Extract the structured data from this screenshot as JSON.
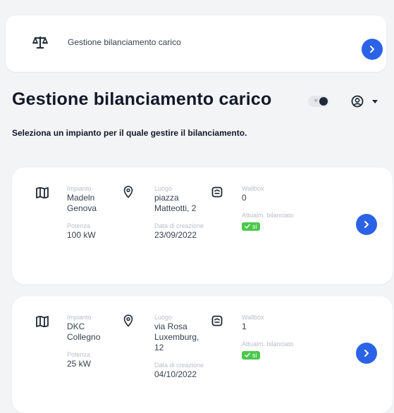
{
  "top_card": {
    "title": "Gestione bilanciamento carico"
  },
  "header": {
    "title": "Gestione bilanciamento carico",
    "toggle_mark": "☀",
    "subtitle": "Seleziona un impianto per il quale gestire il bilanciamento."
  },
  "labels": {
    "impianto": "Impianto",
    "potenza": "Potenza",
    "luogo": "Luogo",
    "data_creazione": "Data di creazione",
    "wallbox": "Wallbox",
    "bilanciato": "Attualm. bilanciato"
  },
  "plants": [
    {
      "name": "Madeln Genova",
      "power": "100 kW",
      "location": "piazza Matteotti, 2",
      "created": "23/09/2022",
      "wallbox": "0",
      "balanced": "si"
    },
    {
      "name": "DKC Collegno",
      "power": "25 kW",
      "location": "via Rosa Luxemburg, 12",
      "created": "04/10/2022",
      "wallbox": "1",
      "balanced": "si"
    }
  ],
  "colors": {
    "accent": "#2c63e6",
    "success": "#4bc84b"
  }
}
